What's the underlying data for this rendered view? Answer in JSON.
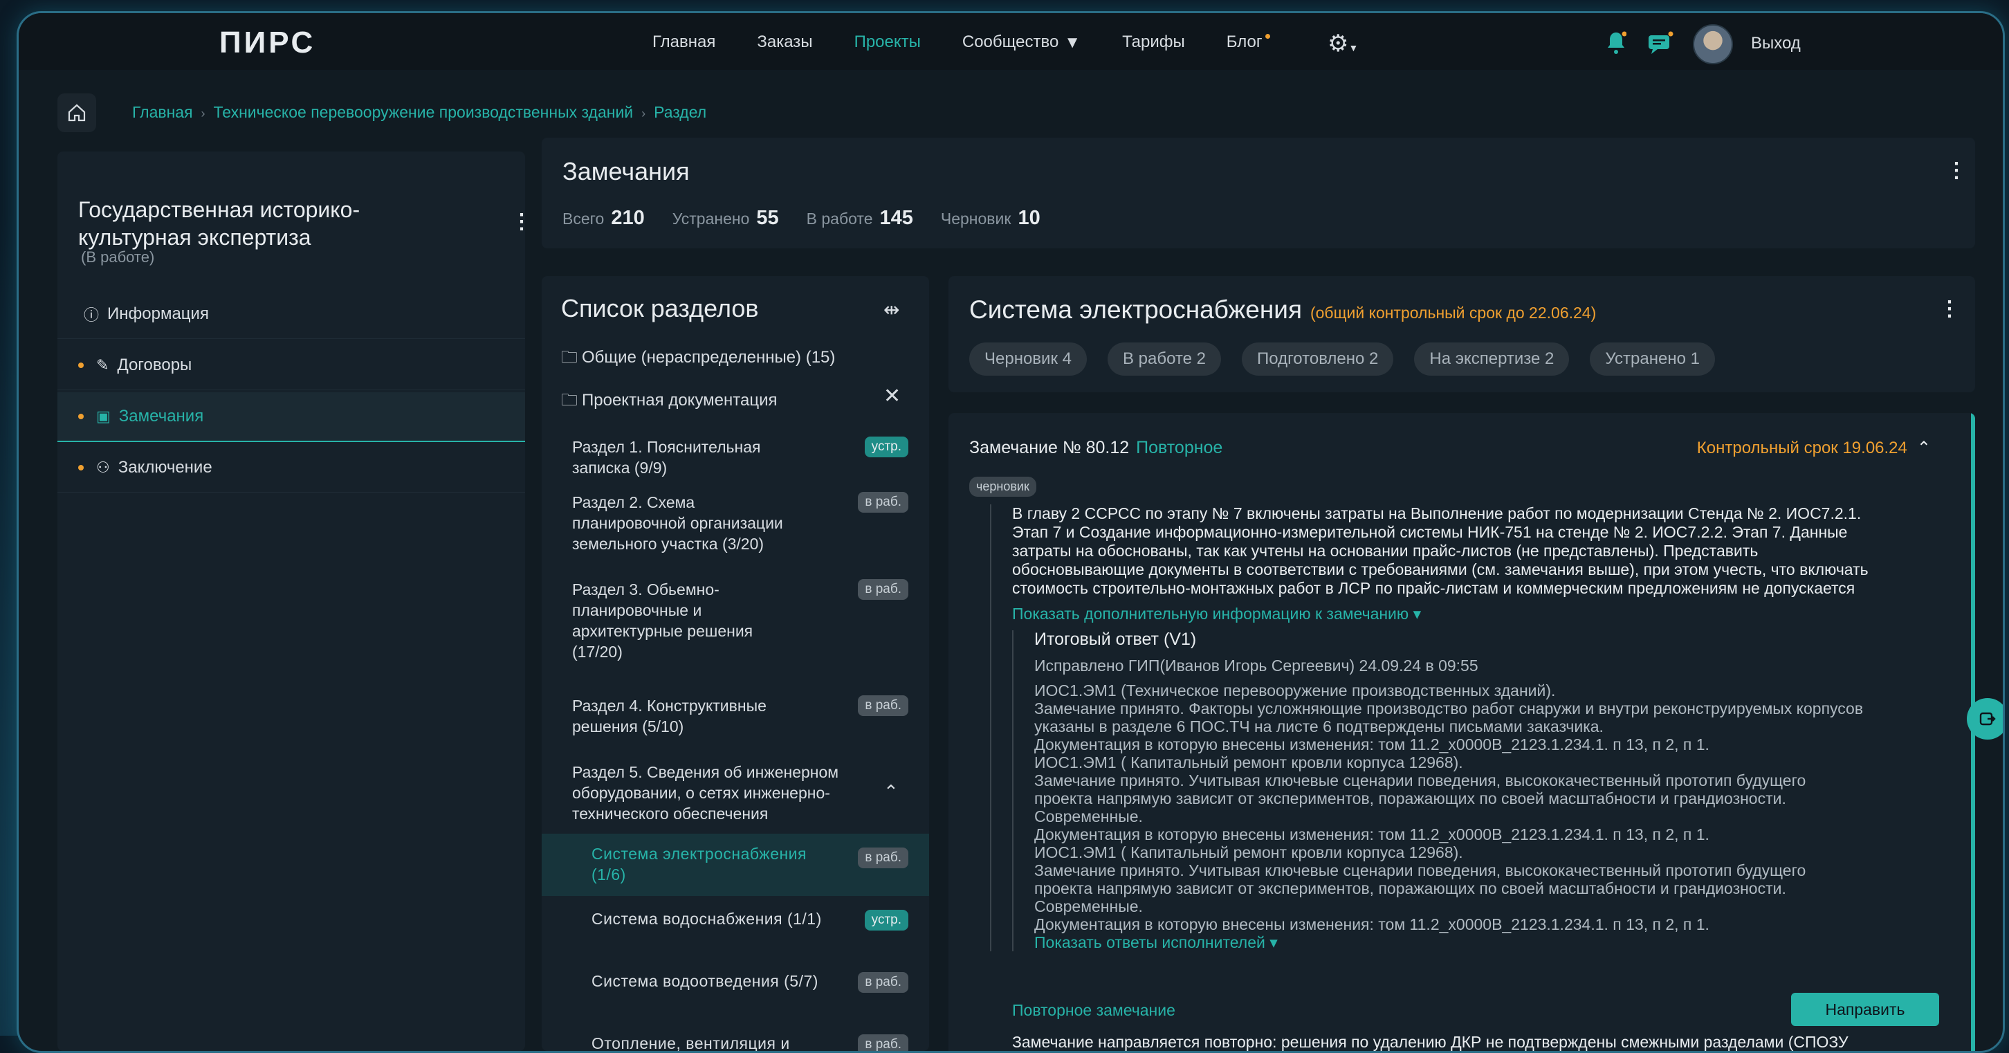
{
  "app": {
    "logo": "ПИРС"
  },
  "nav": [
    {
      "label": "Главная",
      "active": false
    },
    {
      "label": "Заказы",
      "active": false
    },
    {
      "label": "Проекты",
      "active": true
    },
    {
      "label": "Сообщество",
      "active": false
    },
    {
      "label": "Тарифы",
      "active": false
    },
    {
      "label": "Блог",
      "active": false
    }
  ],
  "header": {
    "logout": "Выход"
  },
  "breadcrumb": [
    "Главная",
    "Техническое перевооружение производственных зданий",
    "Раздел"
  ],
  "sidebar": {
    "title": "Государственная историко-культурная экспертиза",
    "status": "(В работе)",
    "items": [
      {
        "label": "Информация"
      },
      {
        "label": "Договоры"
      },
      {
        "label": "Замечания"
      },
      {
        "label": "Заключение"
      }
    ]
  },
  "summary": {
    "title": "Замечания",
    "stats": [
      {
        "label": "Всего",
        "value": "210"
      },
      {
        "label": "Устранено",
        "value": "55"
      },
      {
        "label": "В работе",
        "value": "145"
      },
      {
        "label": "Черновик",
        "value": "10"
      }
    ]
  },
  "seclist": {
    "title": "Список разделов",
    "folders": [
      {
        "label": "Общие (нераспределенные) (15)"
      },
      {
        "label": "Проектная документация"
      }
    ],
    "sections": [
      {
        "label": "Раздел 1. Пояснительная записка (9/9)",
        "badge": "устр."
      },
      {
        "label": "Раздел 2. Схема планировочной организации земельного участка (3/20)",
        "badge": "в раб."
      },
      {
        "label": "Раздел 3. Обьемно-планировочные и архитектурные решения (17/20)",
        "badge": "в раб."
      },
      {
        "label": "Раздел 4. Конструктивные решения (5/10)",
        "badge": "в раб."
      },
      {
        "label": "Раздел 5. Сведения об инженерном оборудовании, о сетях инженерно-технического обеспечения",
        "badge": ""
      },
      {
        "label": "Система электроснабжения (1/6)",
        "badge": "в раб."
      },
      {
        "label": "Система водоснабжения (1/1)",
        "badge": "устр."
      },
      {
        "label": "Система водоотведения (5/7)",
        "badge": "в раб."
      },
      {
        "label": "Отопление, вентиляция и",
        "badge": "в раб."
      }
    ]
  },
  "system": {
    "title": "Система электроснабжения",
    "deadline_note": "(общий контрольный срок до 22.06.24)",
    "chips": [
      "Черновик 4",
      "В работе 2",
      "Подготовлено 2",
      "На экспертизе 2",
      "Устранено 1"
    ]
  },
  "remark": {
    "title": "Замечание № 80.12",
    "repeat": "Повторное",
    "deadline": "Контрольный срок 19.06.24",
    "tag": "черновик",
    "body_lines": [
      "В главу 2 ССРСС по этапу № 7 включены затраты на Выполнение работ по модернизации Стенда № 2. ИОС7.2.1.",
      "Этап 7 и Создание информационно-измерительной системы НИК-751 на стенде № 2. ИОС7.2.2. Этап 7. Данные",
      "затраты на обоснованы, так как учтены на основании прайс-листов (не представлены). Представить",
      "обосновывающие документы в соответствии с требованиями (см. замечания выше), при этом учесть, что включать",
      "стоимость строительно-монтажных работ в ЛСР по прайс-листам и коммерческим предложениям не допускается"
    ],
    "more_info": "Показать дополнительную информацию к замечанию",
    "answer": {
      "title": "Итоговый ответ (V1)",
      "fixed_by": "Исправлено ГИП(Иванов Игорь Сергеевич) 24.09.24 в 09:55",
      "lines": [
        "ИОС1.ЭМ1 (Техническое перевооружение производственных зданий).",
        "Замечание принято. Факторы усложняющие производство работ снаружи и внутри реконструируемых корпусов",
        "указаны в разделе 6 ПОС.ТЧ на листе 6 подтверждены письмами заказчика.",
        "Документация в которую внесены изменения: том 11.2_x0000В_2123.1.234.1. п 13, п 2, п 1.",
        "ИОС1.ЭМ1 ( Капитальный ремонт кровли корпуса 12968).",
        "Замечание принято.  Учитывая ключевые сценарии поведения, высококачественный прототип будущего",
        "проекта напрямую зависит от экспериментов, поражающих по своей масштабности и грандиозности.",
        "Современные.",
        "Документация в которую внесены изменения: том 11.2_x0000В_2123.1.234.1. п 13, п 2, п 1.",
        "ИОС1.ЭМ1 ( Капитальный ремонт кровли корпуса 12968).",
        "Замечание принято. Учитывая ключевые сценарии поведения, высококачественный прототип будущего",
        "проекта напрямую зависит от экспериментов, поражающих по своей масштабности и грандиозности.",
        "Современные.",
        "Документация в которую внесены изменения: том 11.2_x0000В_2123.1.234.1. п 13, п 2, п 1."
      ],
      "show_answers": "Показать ответы исполнителей"
    },
    "repeat_label": "Повторное замечание",
    "send": "Направить",
    "repeat_text": "Замечание направляется повторно: решения по удалению ДКР не подтверждены смежными разделами (СПОЗУ"
  }
}
